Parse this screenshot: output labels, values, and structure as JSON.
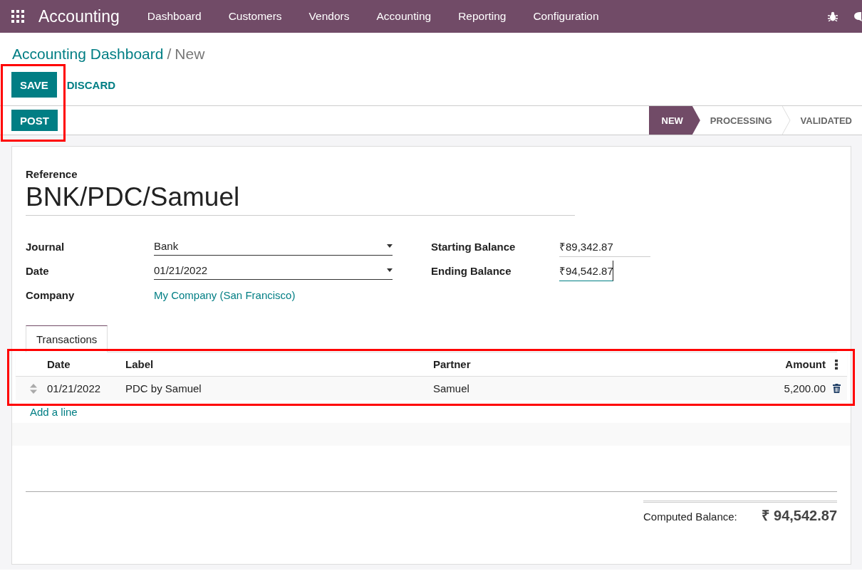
{
  "navbar": {
    "app_name": "Accounting",
    "menu": [
      "Dashboard",
      "Customers",
      "Vendors",
      "Accounting",
      "Reporting",
      "Configuration"
    ]
  },
  "breadcrumb": {
    "parent": "Accounting Dashboard",
    "separator": "/",
    "current": "New"
  },
  "buttons": {
    "highlighted": true,
    "save": "SAVE",
    "discard": "DISCARD",
    "post": "POST"
  },
  "stages": [
    {
      "label": "NEW",
      "selected": true
    },
    {
      "label": "PROCESSING",
      "selected": false
    },
    {
      "label": "VALIDATED",
      "selected": false
    }
  ],
  "form": {
    "reference_label": "Reference",
    "reference": "BNK/PDC/Samuel",
    "left_fields": [
      {
        "label": "Journal",
        "value": "Bank",
        "kind": "select"
      },
      {
        "label": "Date",
        "value": "01/21/2022",
        "kind": "select"
      },
      {
        "label": "Company",
        "value": "My Company (San Francisco)",
        "kind": "link"
      }
    ],
    "right_fields": [
      {
        "label": "Starting Balance",
        "value": "₹89,342.87",
        "focused": false
      },
      {
        "label": "Ending Balance",
        "value": "₹94,542.87",
        "focused": true
      }
    ]
  },
  "tabs": [
    {
      "label": "Transactions",
      "selected": true
    }
  ],
  "table": {
    "highlighted": true,
    "columns": [
      "Date",
      "Label",
      "Partner",
      "Amount"
    ],
    "rows": [
      {
        "date": "01/21/2022",
        "label": "PDC by Samuel",
        "partner": "Samuel",
        "amount": "5,200.00"
      }
    ],
    "add_line": "Add a line"
  },
  "totals": {
    "label": "Computed Balance:",
    "value": "₹ 94,542.87"
  }
}
